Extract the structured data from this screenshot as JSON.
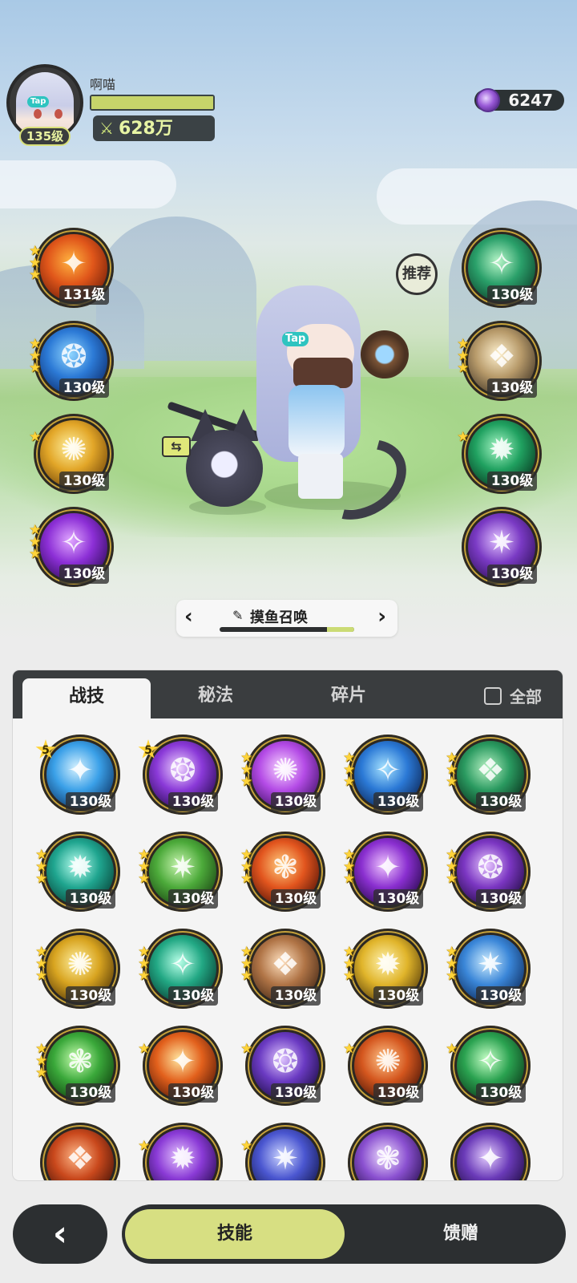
{
  "player": {
    "name": "啊喵",
    "level": "135级",
    "avatar_tag": "Tap",
    "exp_fraction": 1.0,
    "power": "628万",
    "power_icon": "crossed-swords-icon"
  },
  "currency": {
    "amount": "6247",
    "icon": "purple-gem-icon"
  },
  "recommend_label": "推荐",
  "hero_tag": "Tap",
  "swap_icon_glyph": "⇆",
  "equipped_left": [
    {
      "level": "131级",
      "stars": 3,
      "icon": "fire-fist-icon",
      "colors": [
        "#ffb340",
        "#e0561a",
        "#6a1a08"
      ]
    },
    {
      "level": "130级",
      "stars": 3,
      "icon": "ice-shield-icon",
      "colors": [
        "#8fd6ff",
        "#2c7ad6",
        "#0b2766"
      ]
    },
    {
      "level": "130级",
      "stars": 1,
      "icon": "golden-totem-icon",
      "colors": [
        "#fff1a0",
        "#e2a628",
        "#6e4208"
      ]
    },
    {
      "level": "130级",
      "stars": 3,
      "icon": "arcane-star-icon",
      "colors": [
        "#e0a6ff",
        "#8c2fd6",
        "#2a0a52"
      ]
    }
  ],
  "equipped_right": [
    {
      "level": "130级",
      "stars": 0,
      "icon": "green-sword-icon",
      "colors": [
        "#b7f5c8",
        "#2aa06a",
        "#0b3a26"
      ]
    },
    {
      "level": "130级",
      "stars": 3,
      "icon": "light-halo-icon",
      "colors": [
        "#fff2d0",
        "#b79a6a",
        "#3a2f22"
      ]
    },
    {
      "level": "130级",
      "stars": 1,
      "icon": "green-sparkle-icon",
      "colors": [
        "#a8f7c6",
        "#20a160",
        "#06311c"
      ]
    },
    {
      "level": "130级",
      "stars": 0,
      "icon": "purple-crystal-icon",
      "colors": [
        "#e1c2ff",
        "#7a3ac4",
        "#2a0f52"
      ]
    }
  ],
  "build": {
    "name": "摸鱼召唤",
    "progress": 0.2,
    "edit_icon": "pencil-icon"
  },
  "tabs": [
    {
      "label": "战技",
      "active": true
    },
    {
      "label": "秘法",
      "active": false
    },
    {
      "label": "碎片",
      "active": false
    }
  ],
  "all_toggle_label": "全部",
  "skills": [
    {
      "level": "130级",
      "stars": 0,
      "badge": "5",
      "icon": "ice-burst-icon",
      "colors": [
        "#d6f2ff",
        "#3aa0e8",
        "#0b2d5c"
      ]
    },
    {
      "level": "130级",
      "stars": 0,
      "badge": "5",
      "icon": "void-star-icon",
      "colors": [
        "#f0d6ff",
        "#8a39d8",
        "#230a4a"
      ]
    },
    {
      "level": "130级",
      "stars": 3,
      "badge": "",
      "icon": "violet-nova-icon",
      "colors": [
        "#f7d6ff",
        "#b44be6",
        "#3a0f60"
      ]
    },
    {
      "level": "130级",
      "stars": 3,
      "badge": "",
      "icon": "blue-flame-icon",
      "colors": [
        "#a6e3ff",
        "#2b79d6",
        "#0a1f4a"
      ]
    },
    {
      "level": "130级",
      "stars": 3,
      "badge": "",
      "icon": "thorn-vine-icon",
      "colors": [
        "#b8f2c4",
        "#2a9a60",
        "#072a18"
      ]
    },
    {
      "level": "130级",
      "stars": 3,
      "badge": "",
      "icon": "tide-swirl-icon",
      "colors": [
        "#b9fff0",
        "#1fa58f",
        "#063a30"
      ]
    },
    {
      "level": "130级",
      "stars": 3,
      "badge": "",
      "icon": "green-scroll-icon",
      "colors": [
        "#c9f5b0",
        "#4caa3a",
        "#173d10"
      ]
    },
    {
      "level": "130级",
      "stars": 3,
      "badge": "",
      "icon": "inferno-icon",
      "colors": [
        "#ffcf80",
        "#e2551e",
        "#4a0e05"
      ]
    },
    {
      "level": "130级",
      "stars": 3,
      "badge": "",
      "icon": "void-eye-icon",
      "colors": [
        "#f0c6ff",
        "#8a2fd0",
        "#1f0640"
      ]
    },
    {
      "level": "130级",
      "stars": 3,
      "badge": "",
      "icon": "shadow-hand-icon",
      "colors": [
        "#e7c6ff",
        "#7b36c2",
        "#1d0a3c"
      ]
    },
    {
      "level": "130级",
      "stars": 3,
      "badge": "",
      "icon": "gold-shard-icon",
      "colors": [
        "#fff0a0",
        "#d8a420",
        "#4a3006"
      ]
    },
    {
      "level": "130级",
      "stars": 3,
      "badge": "",
      "icon": "jade-wind-icon",
      "colors": [
        "#b9ffe8",
        "#22a884",
        "#06342a"
      ]
    },
    {
      "level": "130级",
      "stars": 3,
      "badge": "",
      "icon": "ember-cards-icon",
      "colors": [
        "#ffe1c0",
        "#b07446",
        "#3c2212"
      ]
    },
    {
      "level": "130级",
      "stars": 3,
      "badge": "",
      "icon": "holy-cross-icon",
      "colors": [
        "#fff3b0",
        "#e0b42a",
        "#4e3608"
      ]
    },
    {
      "level": "130级",
      "stars": 3,
      "badge": "",
      "icon": "frost-shard-icon",
      "colors": [
        "#cfeeff",
        "#3a86d8",
        "#0a2452"
      ]
    },
    {
      "level": "130级",
      "stars": 3,
      "badge": "",
      "icon": "verdant-flame-icon",
      "colors": [
        "#c9ffb0",
        "#3aa83a",
        "#0d3a0c"
      ]
    },
    {
      "level": "130级",
      "stars": 1,
      "badge": "",
      "icon": "solar-orb-icon",
      "colors": [
        "#ffe6a0",
        "#e2601c",
        "#4a1406"
      ]
    },
    {
      "level": "130级",
      "stars": 1,
      "badge": "",
      "icon": "dusk-moon-icon",
      "colors": [
        "#e0c6ff",
        "#6a3ac2",
        "#160a3a"
      ]
    },
    {
      "level": "130级",
      "stars": 1,
      "badge": "",
      "icon": "flame-totem-icon",
      "colors": [
        "#ffc68a",
        "#d4561e",
        "#3e1006"
      ]
    },
    {
      "level": "130级",
      "stars": 1,
      "badge": "",
      "icon": "heal-cross-icon",
      "colors": [
        "#c6ffc6",
        "#2aa250",
        "#0a3216"
      ]
    },
    {
      "level": "",
      "stars": 0,
      "badge": "",
      "icon": "ember-ring-icon",
      "colors": [
        "#ffb98a",
        "#c9481c",
        "#3a0e06"
      ]
    },
    {
      "level": "",
      "stars": 1,
      "badge": "",
      "icon": "purple-beast-icon",
      "colors": [
        "#e6c6ff",
        "#8a3ad6",
        "#200a44"
      ]
    },
    {
      "level": "",
      "stars": 1,
      "badge": "",
      "icon": "vortex-icon",
      "colors": [
        "#cdd6ff",
        "#4a56d0",
        "#0e1240"
      ]
    },
    {
      "level": "",
      "stars": 0,
      "badge": "",
      "icon": "sigil-icon",
      "colors": [
        "#f0e0ff",
        "#8a50d0",
        "#220c46"
      ]
    },
    {
      "level": "",
      "stars": 0,
      "badge": "",
      "icon": "crest-icon",
      "colors": [
        "#e6d0ff",
        "#6a3ab8",
        "#1a0a3a"
      ]
    }
  ],
  "nav": {
    "back_icon": "back-arrow-icon",
    "skills_label": "技能",
    "gift_label": "馈赠"
  }
}
